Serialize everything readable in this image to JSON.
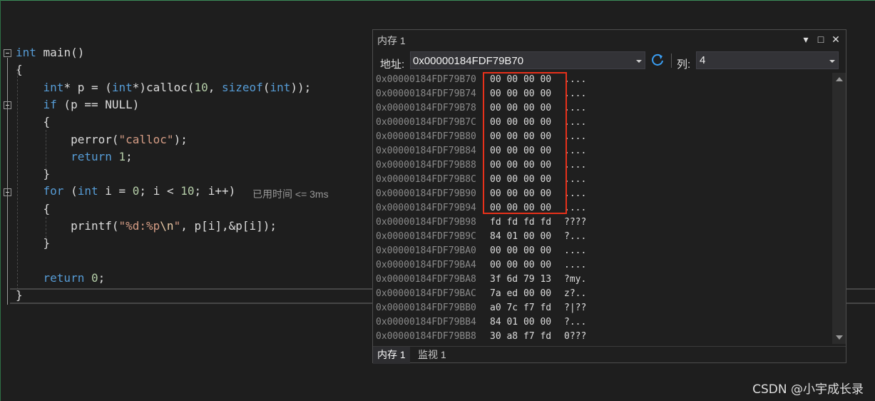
{
  "editor": {
    "lines": [
      {
        "id": "l1",
        "html": "<span class='kw'>int</span> main()"
      },
      {
        "id": "l2",
        "html": "{"
      },
      {
        "id": "l3",
        "html": "    <span class='kw'>int</span>* p = (<span class='kw'>int</span>*)calloc(<span class='num'>10</span>, <span class='kw'>sizeof</span>(<span class='kw'>int</span>));"
      },
      {
        "id": "l4",
        "html": "    <span class='kw'>if</span> (p == NULL)"
      },
      {
        "id": "l5",
        "html": "    {"
      },
      {
        "id": "l6",
        "html": "        perror(<span class='str'>\"calloc\"</span>);"
      },
      {
        "id": "l7",
        "html": "        <span class='kw'>return</span> <span class='num'>1</span>;"
      },
      {
        "id": "l8",
        "html": "    }"
      },
      {
        "id": "l9",
        "html": "    <span class='kw'>for</span> (<span class='kw'>int</span> i = <span class='num'>0</span>; i &lt; <span class='num'>10</span>; i++)"
      },
      {
        "id": "l10",
        "html": "    {"
      },
      {
        "id": "l11",
        "html": "        printf(<span class='str'>\"%d:%p<span class='esc'>\\n</span>\"</span>, p[i],&amp;p[i]);"
      },
      {
        "id": "l12",
        "html": "    }"
      },
      {
        "id": "l13",
        "html": ""
      },
      {
        "id": "l14",
        "html": "    <span class='kw'>return</span> <span class='num'>0</span>;"
      },
      {
        "id": "l15",
        "html": "}"
      }
    ],
    "elapsed_hint": "已用时间 <= 3ms"
  },
  "memory_window": {
    "title": "内存 1",
    "controls": {
      "dropdown": "▾",
      "maximize": "□",
      "close": "✕"
    },
    "address_label": "地址:",
    "address_value": "0x00000184FDF79B70",
    "columns_label": "列:",
    "columns_value": "4",
    "rows": [
      {
        "addr": "0x00000184FDF79B70",
        "hex": "00 00 00 00",
        "text": "...."
      },
      {
        "addr": "0x00000184FDF79B74",
        "hex": "00 00 00 00",
        "text": "...."
      },
      {
        "addr": "0x00000184FDF79B78",
        "hex": "00 00 00 00",
        "text": "...."
      },
      {
        "addr": "0x00000184FDF79B7C",
        "hex": "00 00 00 00",
        "text": "...."
      },
      {
        "addr": "0x00000184FDF79B80",
        "hex": "00 00 00 00",
        "text": "...."
      },
      {
        "addr": "0x00000184FDF79B84",
        "hex": "00 00 00 00",
        "text": "...."
      },
      {
        "addr": "0x00000184FDF79B88",
        "hex": "00 00 00 00",
        "text": "...."
      },
      {
        "addr": "0x00000184FDF79B8C",
        "hex": "00 00 00 00",
        "text": "...."
      },
      {
        "addr": "0x00000184FDF79B90",
        "hex": "00 00 00 00",
        "text": "...."
      },
      {
        "addr": "0x00000184FDF79B94",
        "hex": "00 00 00 00",
        "text": "...."
      },
      {
        "addr": "0x00000184FDF79B98",
        "hex": "fd fd fd fd",
        "text": "????"
      },
      {
        "addr": "0x00000184FDF79B9C",
        "hex": "84 01 00 00",
        "text": "?..."
      },
      {
        "addr": "0x00000184FDF79BA0",
        "hex": "00 00 00 00",
        "text": "...."
      },
      {
        "addr": "0x00000184FDF79BA4",
        "hex": "00 00 00 00",
        "text": "...."
      },
      {
        "addr": "0x00000184FDF79BA8",
        "hex": "3f 6d 79 13",
        "text": "?my."
      },
      {
        "addr": "0x00000184FDF79BAC",
        "hex": "7a ed 00 00",
        "text": "z?.."
      },
      {
        "addr": "0x00000184FDF79BB0",
        "hex": "a0 7c f7 fd",
        "text": "?|??"
      },
      {
        "addr": "0x00000184FDF79BB4",
        "hex": "84 01 00 00",
        "text": "?..."
      },
      {
        "addr": "0x00000184FDF79BB8",
        "hex": "30 a8 f7 fd",
        "text": "0???"
      }
    ],
    "tabs": [
      {
        "label": "内存 1",
        "active": true
      },
      {
        "label": "监视 1",
        "active": false
      }
    ]
  },
  "watermark": "CSDN @小宇成长录",
  "colors": {
    "highlight_box": "#e8311a",
    "keyword": "#569cd6",
    "string": "#d69d85",
    "number": "#b5cea8"
  }
}
